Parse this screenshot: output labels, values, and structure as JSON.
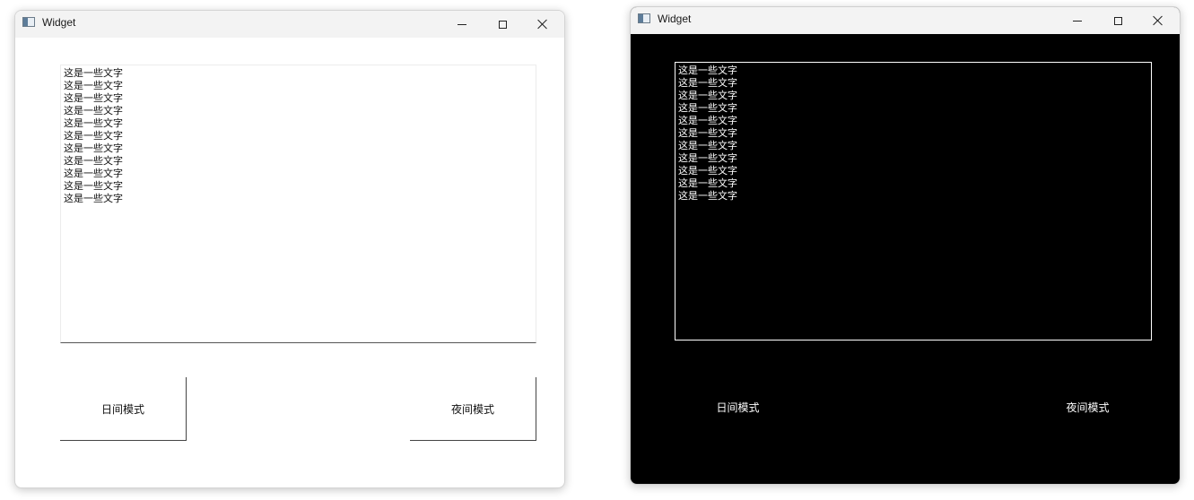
{
  "windows": [
    {
      "theme": "light",
      "title": "Widget",
      "text_lines": [
        "这是一些文字",
        "这是一些文字",
        "这是一些文字",
        "这是一些文字",
        "这是一些文字",
        "这是一些文字",
        "这是一些文字",
        "这是一些文字",
        "这是一些文字",
        "这是一些文字",
        "这是一些文字"
      ],
      "day_button": "日间模式",
      "night_button": "夜间模式",
      "colors": {
        "background": "#ffffff",
        "text": "#111111"
      }
    },
    {
      "theme": "dark",
      "title": "Widget",
      "text_lines": [
        "这是一些文字",
        "这是一些文字",
        "这是一些文字",
        "这是一些文字",
        "这是一些文字",
        "这是一些文字",
        "这是一些文字",
        "这是一些文字",
        "这是一些文字",
        "这是一些文字",
        "这是一些文字"
      ],
      "day_button": "日间模式",
      "night_button": "夜间模式",
      "colors": {
        "background": "#000000",
        "text": "#ffffff"
      }
    }
  ],
  "icons": {
    "app": "app-window-icon",
    "minimize": "minimize-icon",
    "maximize": "maximize-icon",
    "close": "close-icon"
  }
}
